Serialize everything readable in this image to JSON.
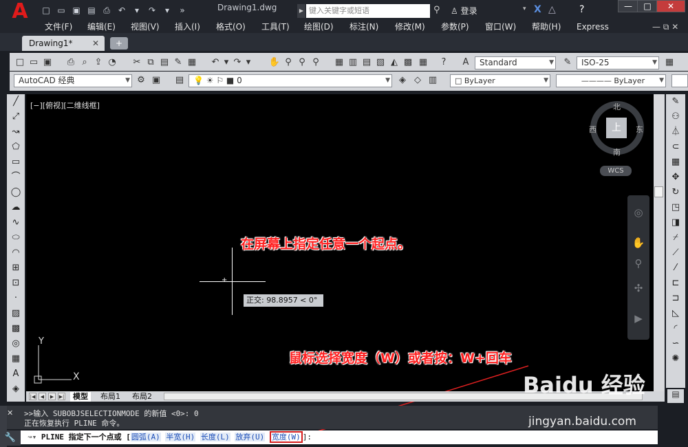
{
  "app": {
    "logo": "A",
    "document_title": "Drawing1.dwg",
    "search_placeholder": "键入关键字或短语",
    "login_label": "登录"
  },
  "menubar": [
    "文件(F)",
    "编辑(E)",
    "视图(V)",
    "插入(I)",
    "格式(O)",
    "工具(T)",
    "绘图(D)",
    "标注(N)",
    "修改(M)",
    "参数(P)",
    "窗口(W)",
    "帮助(H)",
    "Express"
  ],
  "document_tabs": {
    "active": "Drawing1*"
  },
  "toolbar": {
    "text_style": "Standard",
    "dim_style": "ISO-25",
    "workspace": "AutoCAD 经典",
    "layer": "0",
    "color": "ByLayer",
    "linetype": "ByLayer"
  },
  "viewport": {
    "label": "[−][俯视][二维线框]",
    "compass": {
      "north": "北",
      "south": "南",
      "east": "东",
      "west": "西",
      "top": "上"
    },
    "wcs": "WCS",
    "tooltip": "正交: 98.8957 < 0°",
    "ucs_x": "X",
    "ucs_y": "Y"
  },
  "annotations": {
    "callout1": "在屏幕上指定任意一个起点。",
    "callout2": "鼠标选择宽度（W）或者按：W+回车"
  },
  "layout_tabs": [
    "模型",
    "布局1",
    "布局2"
  ],
  "command": {
    "history_line1": ">>输入 SUBOBJSELECTIONMODE 的新值 <0>: 0",
    "history_line2": "正在恢复执行 PLINE 命令。",
    "prompt_prefix": "PLINE 指定下一个点或 [",
    "options": [
      "圆弧(A)",
      "半宽(H)",
      "长度(L)",
      "放弃(U)"
    ],
    "highlighted_option": "宽度(W)",
    "prompt_suffix": "]:"
  },
  "watermark": {
    "brand": "Baidu 经验",
    "url": "jingyan.baidu.com"
  }
}
